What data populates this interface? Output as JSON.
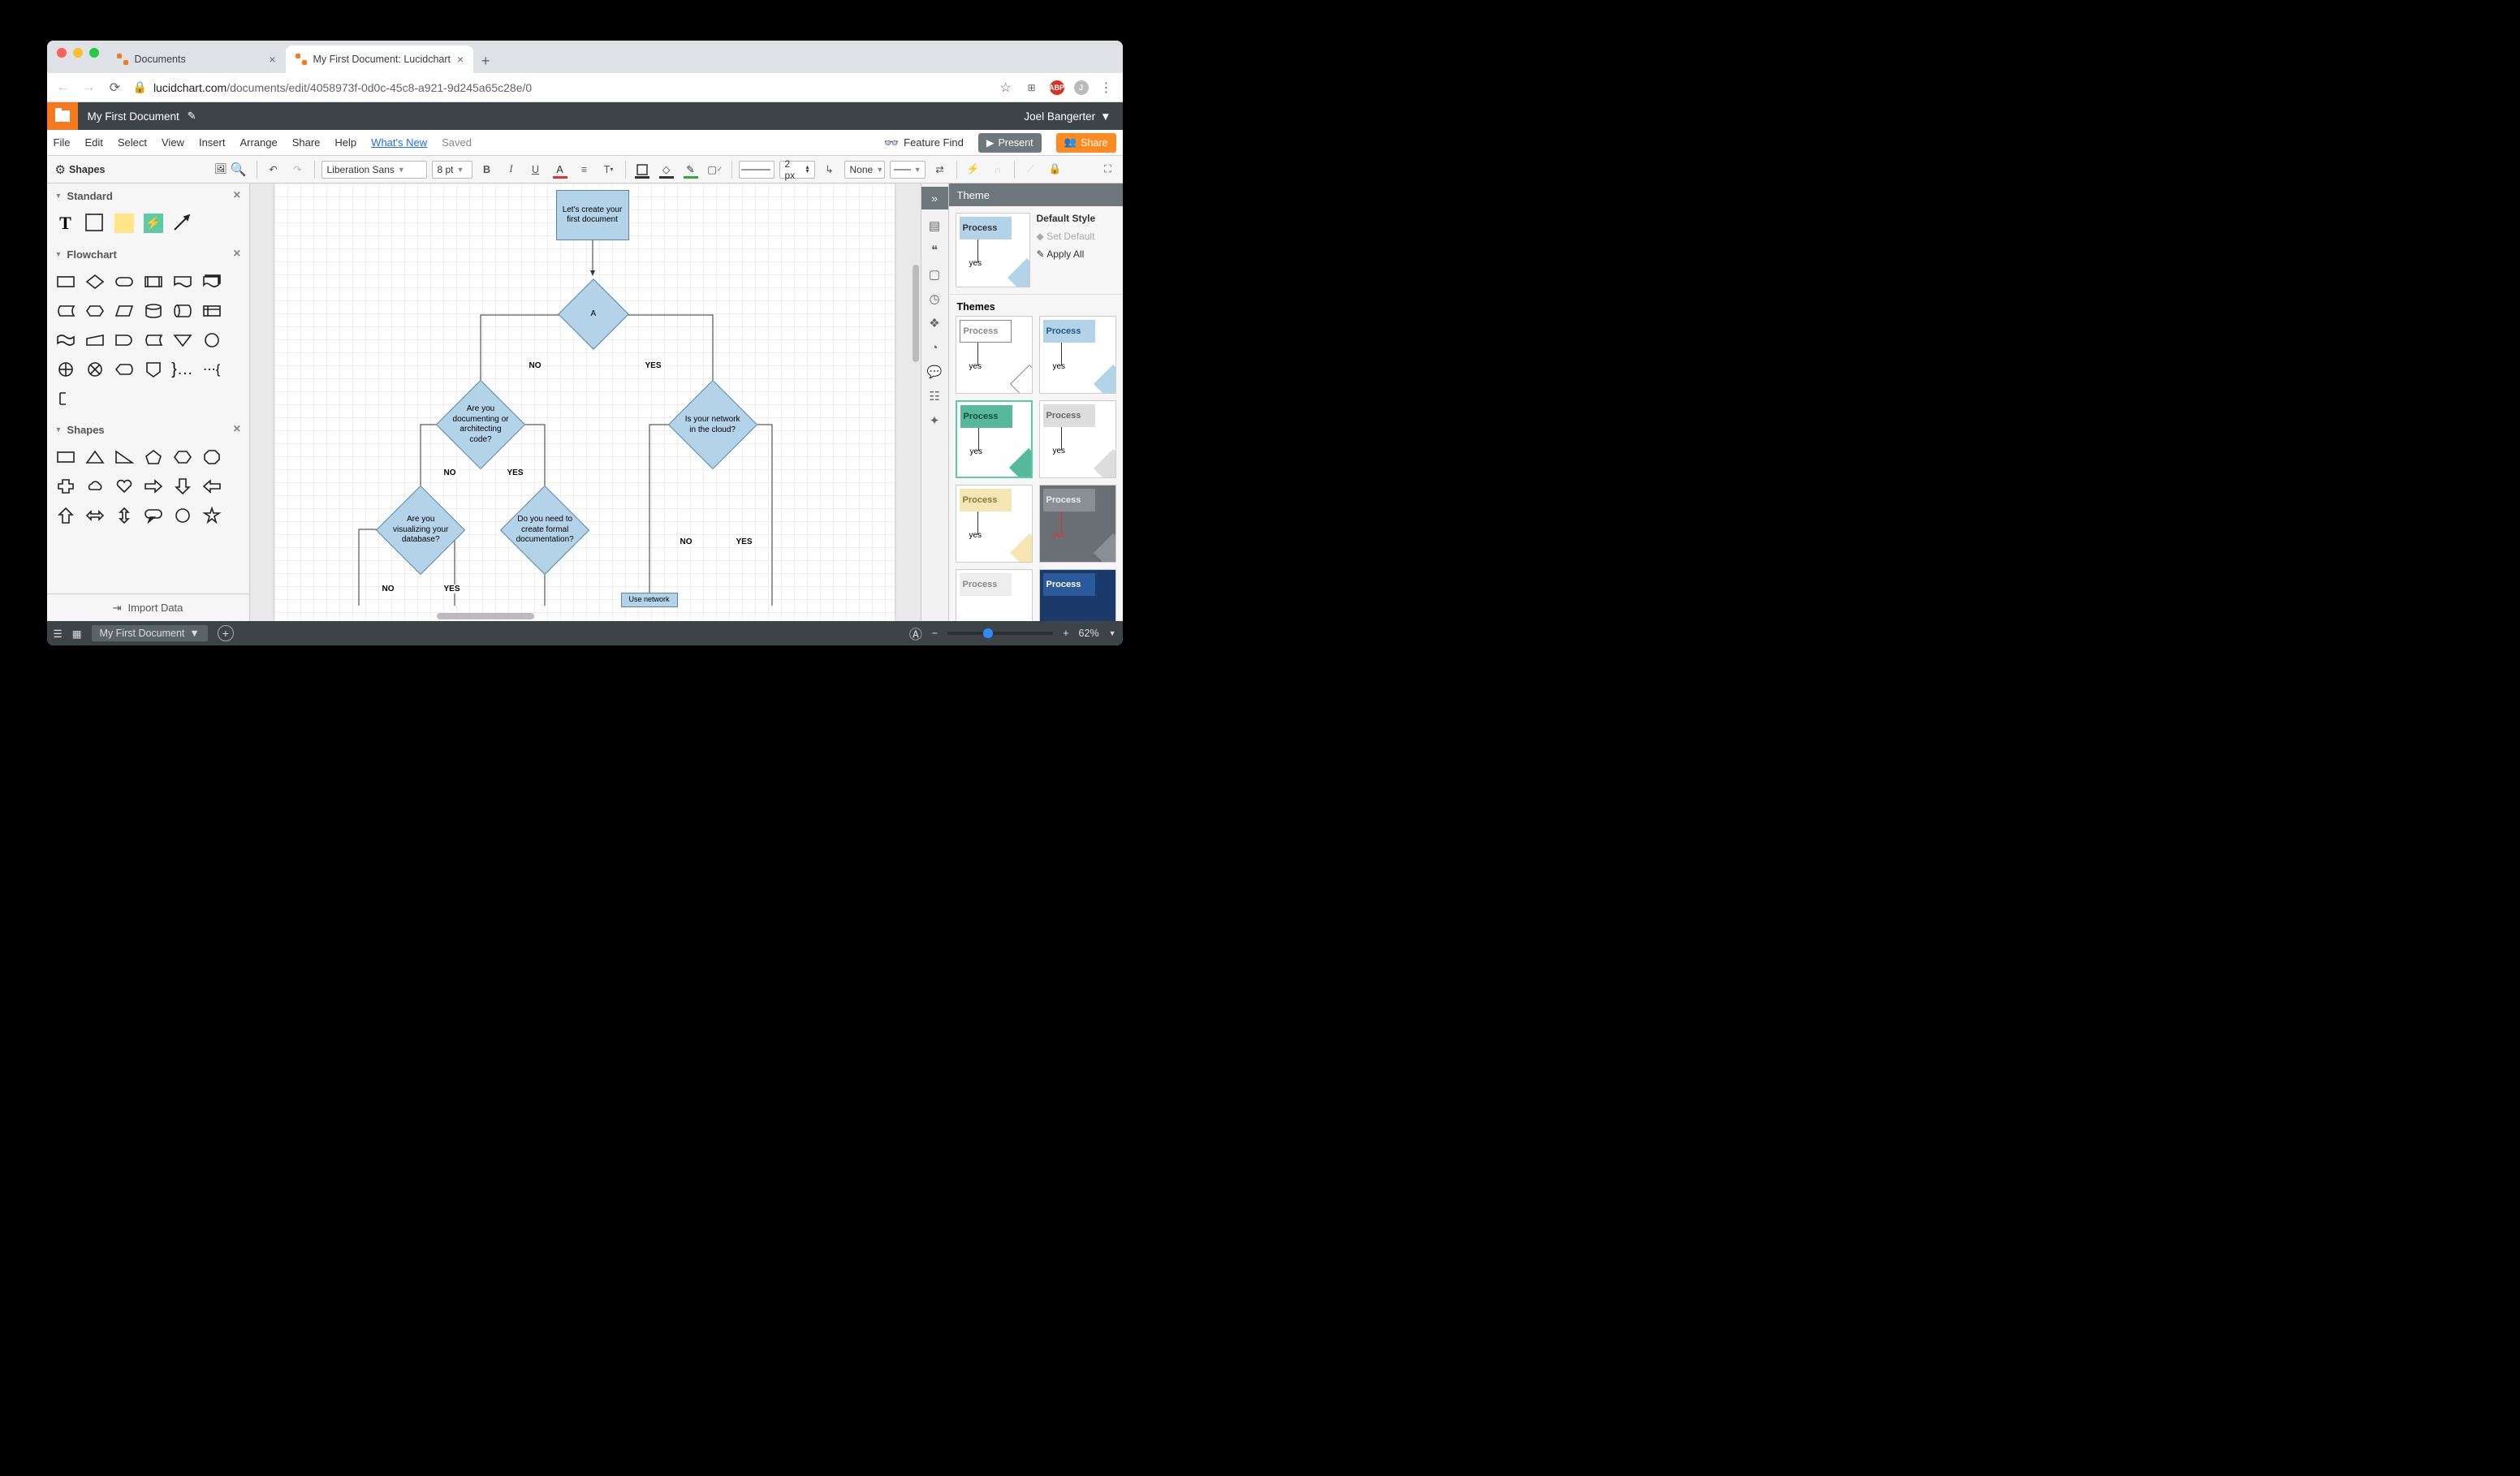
{
  "browser": {
    "tabs": [
      {
        "title": "Documents",
        "active": false
      },
      {
        "title": "My First Document: Lucidchart",
        "active": true
      }
    ],
    "url_domain": "lucidchart.com",
    "url_path": "/documents/edit/4058973f-0d0c-45c8-a921-9d245a65c28e/0"
  },
  "appbar": {
    "doc_title": "My First Document",
    "user": "Joel Bangerter"
  },
  "menu": {
    "items": [
      "File",
      "Edit",
      "Select",
      "View",
      "Insert",
      "Arrange",
      "Share",
      "Help"
    ],
    "whats_new": "What's New",
    "saved": "Saved",
    "feature_find": "Feature Find",
    "present": "Present",
    "share": "Share"
  },
  "toolbar": {
    "font": "Liberation Sans",
    "font_size": "8 pt",
    "stroke_width": "2 px",
    "line_style": "None"
  },
  "shapes_panel": {
    "header": "Shapes",
    "categories": {
      "standard": "Standard",
      "flowchart": "Flowchart",
      "shapes": "Shapes"
    },
    "import": "Import Data"
  },
  "flowchart": {
    "n1": "Let's create your first document",
    "n2": "A",
    "n3": "Are you documenting or architecting code?",
    "n4": "Is your network in the cloud?",
    "n5": "Are you visualizing your database?",
    "n6": "Do you need to create formal documentation?",
    "n7": "Use network",
    "labels": {
      "yes": "YES",
      "no": "NO"
    }
  },
  "theme_panel": {
    "title": "Theme",
    "default_style": "Default Style",
    "set_default": "Set Default",
    "apply_all": "Apply All",
    "themes": "Themes",
    "process": "Process",
    "yes": "yes"
  },
  "bottom": {
    "page_name": "My First Document",
    "zoom": "62%"
  }
}
